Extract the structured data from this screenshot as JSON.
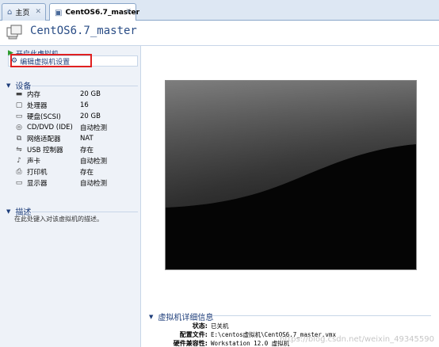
{
  "tabs": [
    {
      "label": "主页",
      "icon": "home-icon"
    },
    {
      "label": "CentOS6.7_master",
      "icon": "vm-tab-icon"
    }
  ],
  "title": "CentOS6.7_master",
  "actions": {
    "start": "开启此虚拟机",
    "edit": "编辑虚拟机设置"
  },
  "devices_section": {
    "title": "设备",
    "items": [
      {
        "name": "内存",
        "value": "20 GB",
        "icon": "memory-icon"
      },
      {
        "name": "处理器",
        "value": "16",
        "icon": "processor-icon"
      },
      {
        "name": "硬盘(SCSI)",
        "value": "20 GB",
        "icon": "harddisk-icon"
      },
      {
        "name": "CD/DVD (IDE)",
        "value": "自动检测",
        "icon": "cdrom-icon"
      },
      {
        "name": "网络适配器",
        "value": "NAT",
        "icon": "network-icon"
      },
      {
        "name": "USB 控制器",
        "value": "存在",
        "icon": "usb-icon"
      },
      {
        "name": "声卡",
        "value": "自动检测",
        "icon": "sound-icon"
      },
      {
        "name": "打印机",
        "value": "存在",
        "icon": "printer-icon"
      },
      {
        "name": "显示器",
        "value": "自动检测",
        "icon": "display-icon"
      }
    ]
  },
  "description_section": {
    "title": "描述",
    "placeholder": "在此处键入对该虚拟机的描述。"
  },
  "details_section": {
    "title": "虚拟机详细信息",
    "rows": [
      {
        "key": "状态:",
        "value": "已关机"
      },
      {
        "key": "配置文件:",
        "value": "E:\\centos虚拟机\\CentOS6.7_master.vmx"
      },
      {
        "key": "硬件兼容性:",
        "value": "Workstation 12.0 虚拟机"
      }
    ]
  },
  "watermark": "https://blog.csdn.net/weixin_49345590",
  "colors": {
    "accent": "#2a4d86",
    "highlight_box": "#e02020",
    "panel_bg": "#eef2f8"
  }
}
